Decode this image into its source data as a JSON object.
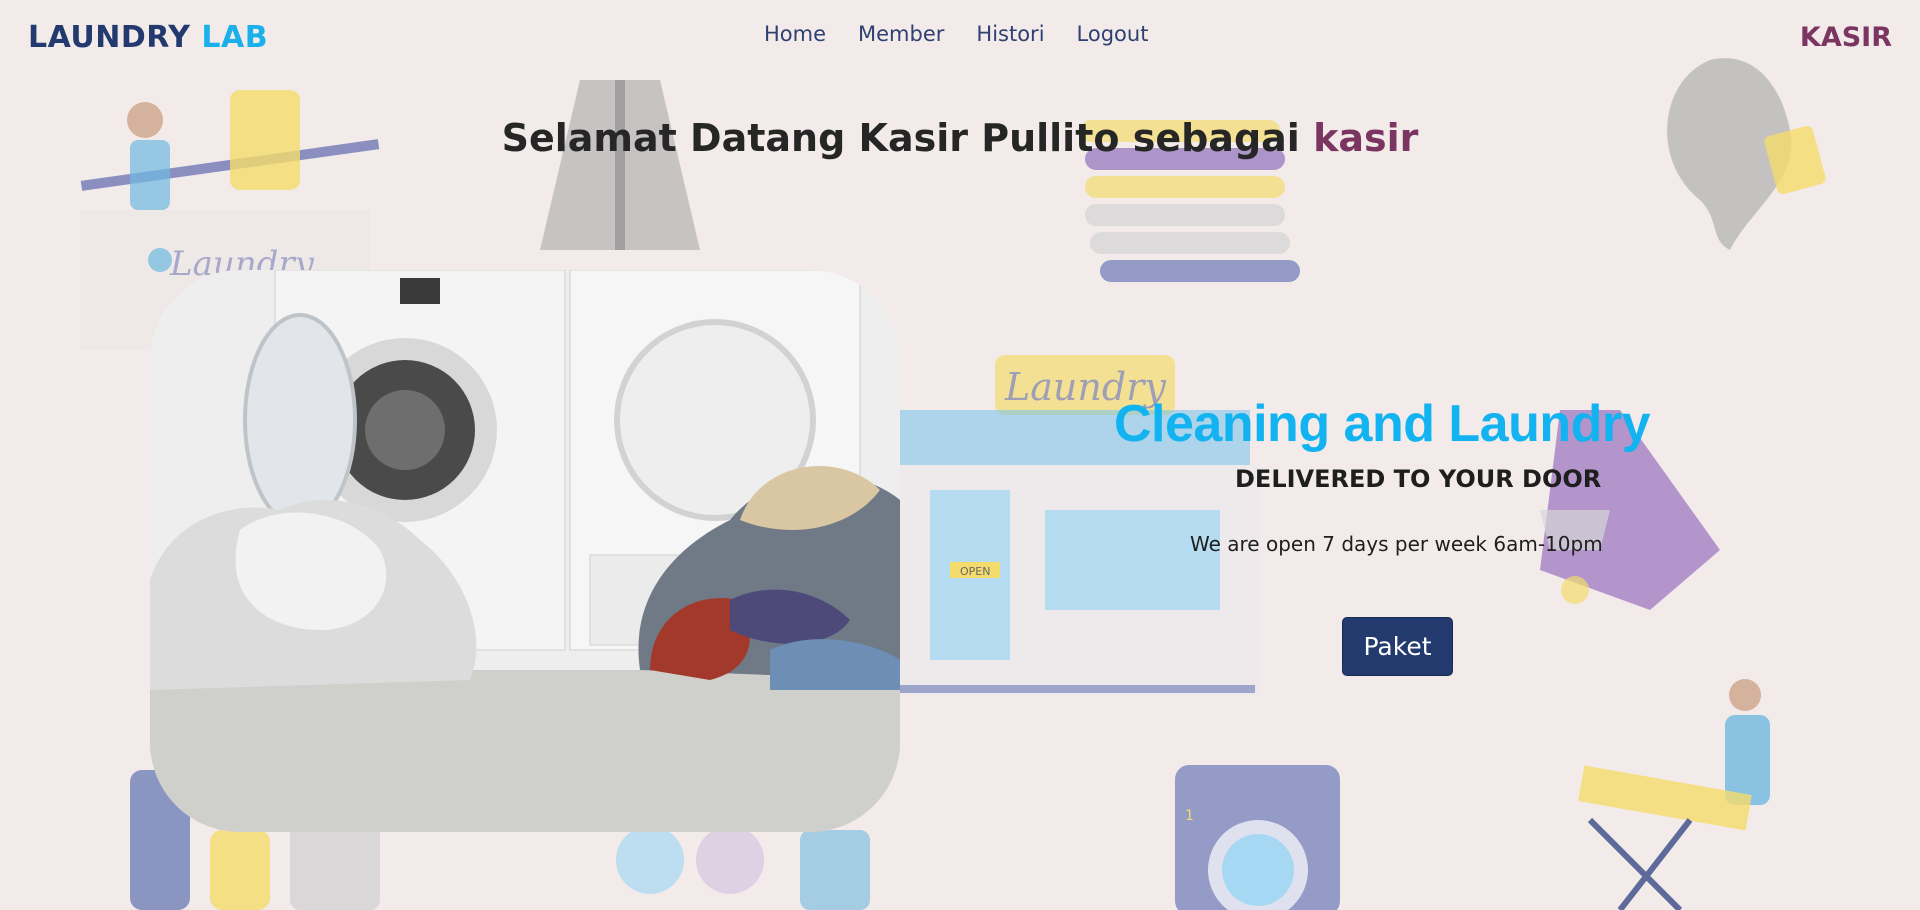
{
  "brand": {
    "part1": "LAUNDRY",
    "part2": "LAB"
  },
  "nav": {
    "items": [
      {
        "label": "Home"
      },
      {
        "label": "Member"
      },
      {
        "label": "Histori"
      },
      {
        "label": "Logout"
      }
    ]
  },
  "role_label": "KASIR",
  "welcome": {
    "text": "Selamat Datang Kasir Pullito sebagai",
    "role": "kasir"
  },
  "hero": {
    "title": "Cleaning and Laundry",
    "subtitle": "DELIVERED TO YOUR DOOR",
    "hours": "We are open 7 days per week 6am-10pm",
    "button_label": "Paket"
  },
  "background": {
    "sign_text": "Laundry",
    "shop_sign": "Laundry",
    "open_sign": "OPEN",
    "machine_number": "1"
  },
  "colors": {
    "brand_dark": "#233a6e",
    "brand_light": "#1ab1ea",
    "accent": "#7a3560",
    "hero_title": "#12b3f0",
    "background": "#f2ebea"
  }
}
